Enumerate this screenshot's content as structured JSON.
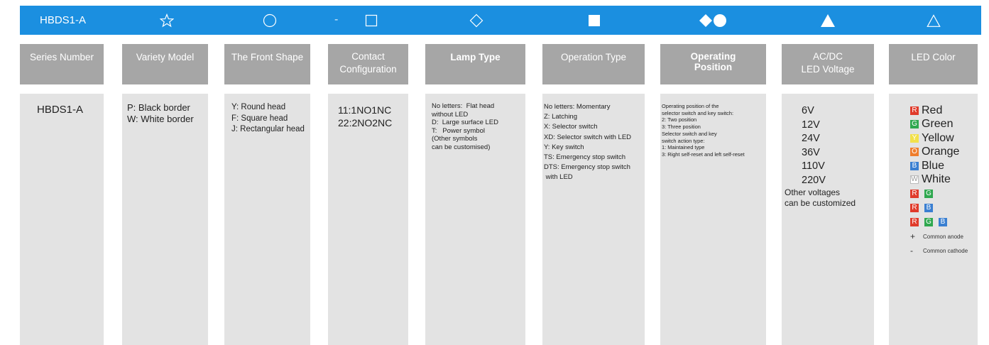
{
  "topbar": {
    "series_code": "HBDS1-A",
    "separator": "-",
    "icons": [
      "star-outline-icon",
      "circle-outline-icon",
      "square-outline-icon",
      "diamond-outline-icon",
      "square-filled-icon",
      "diamond-circle-filled-icon",
      "triangle-filled-icon",
      "triangle-outline-icon"
    ]
  },
  "headers": {
    "series_number": "Series Number",
    "variety_model": "Variety Model",
    "front_shape": "The Front Shape",
    "contact_configuration": "Contact\nConfiguration",
    "lamp_type": "Lamp Type",
    "operation_type": "Operation Type",
    "operating_position": "Operating\nPosition",
    "voltage": "AC/DC\nLED Voltage",
    "led_color": "LED Color"
  },
  "columns": {
    "series_number": "HBDS1-A",
    "variety_model": "P: Black border\nW: White border",
    "front_shape": "Y: Round head\nF: Square head\nJ: Rectangular head",
    "contact_configuration": "11:1NO1NC\n22:2NO2NC",
    "lamp_type": "No letters:  Flat head\nwithout LED\nD:  Large surface LED\nT:   Power symbol\n(Other symbols\ncan be customised)",
    "operation_type": "No letters: Momentary\nZ: Latching\nX: Selector switch\nXD: Selector switch with LED\nY: Key switch\nTS: Emergency stop switch\nDTS: Emergency stop switch\n with LED",
    "operating_position": "Operating position of the\nselector switch and key switch:\n2: Two position\n3: Three position\nSelector switch and key\nswitch action type:\n1: Maintained type\n3: Right self-reset and left self-reset",
    "voltages": [
      "6V",
      "12V",
      "24V",
      "36V",
      "110V",
      "220V"
    ],
    "voltage_note": "Other voltages\ncan be customized",
    "led_colors": [
      {
        "letter": "R",
        "name": "Red",
        "color": "#e03b2b"
      },
      {
        "letter": "G",
        "name": "Green",
        "color": "#2fa84f"
      },
      {
        "letter": "Y",
        "name": "Yellow",
        "color": "#f2e14b"
      },
      {
        "letter": "O",
        "name": "Orange",
        "color": "#ef7d2c"
      },
      {
        "letter": "B",
        "name": "Blue",
        "color": "#3a7fd1"
      },
      {
        "letter": "W",
        "name": "White",
        "color": "#ffffff"
      }
    ],
    "led_combos": [
      [
        "R",
        "G"
      ],
      [
        "R",
        "B"
      ],
      [
        "R",
        "G",
        "B"
      ]
    ],
    "anode_mark": "+",
    "anode_note": "Common anode",
    "cathode_mark": "-",
    "cathode_note": "Common cathode"
  },
  "colors": {
    "topbar_blue": "#1b8fe0",
    "header_gray": "#a6a6a6",
    "column_gray": "#e3e3e3"
  }
}
